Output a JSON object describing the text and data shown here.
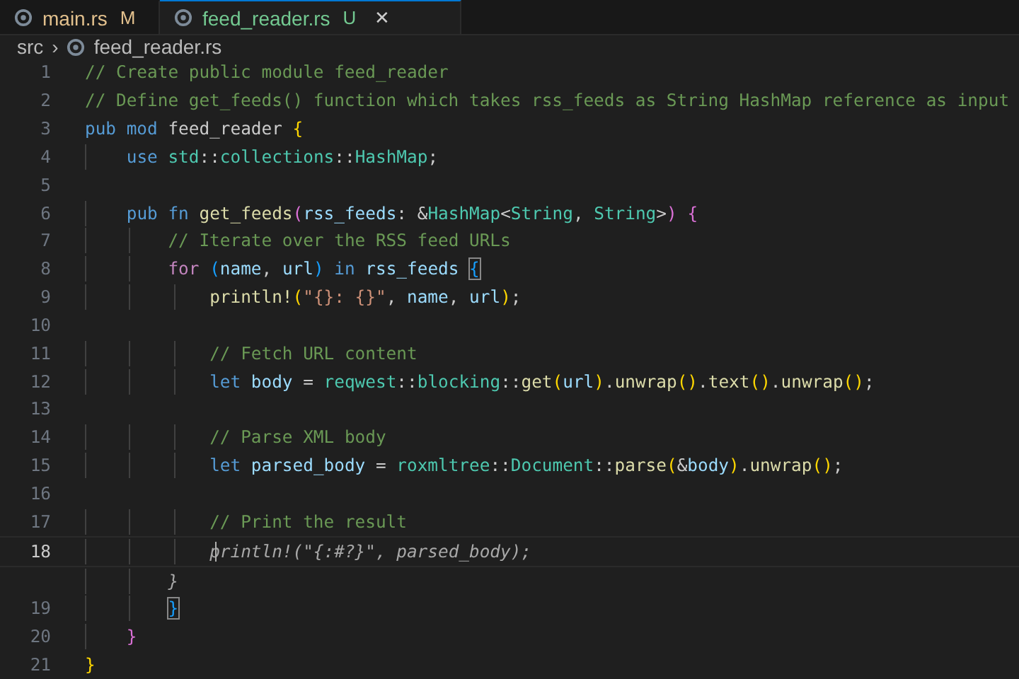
{
  "tabs": [
    {
      "label": "main.rs",
      "badge": "M",
      "selected": false,
      "closable": false
    },
    {
      "label": "feed_reader.rs",
      "badge": "U",
      "selected": true,
      "closable": true
    }
  ],
  "close_glyph": "✕",
  "breadcrumb": {
    "folder": "src",
    "separator": "›",
    "file": "feed_reader.rs"
  },
  "lines": [
    {
      "number": "1",
      "current": false,
      "tokens": [
        {
          "text": "// Create public module feed_reader",
          "kind": "comment"
        }
      ]
    },
    {
      "number": "2",
      "current": false,
      "tokens": [
        {
          "text": "// Define get_feeds() function which takes rss_feeds as String HashMap reference as input",
          "kind": "comment"
        }
      ]
    },
    {
      "number": "3",
      "current": false,
      "tokens": [
        {
          "text": "pub mod ",
          "kind": "keyword"
        },
        {
          "text": "feed_reader ",
          "kind": "plain"
        },
        {
          "text": "{",
          "kind": "bracket1"
        }
      ]
    },
    {
      "number": "4",
      "current": false,
      "tokens": [
        {
          "text": "    use ",
          "kind": "keyword"
        },
        {
          "text": "std",
          "kind": "type"
        },
        {
          "text": "::",
          "kind": "plain"
        },
        {
          "text": "collections",
          "kind": "type"
        },
        {
          "text": "::",
          "kind": "plain"
        },
        {
          "text": "HashMap",
          "kind": "type"
        },
        {
          "text": ";",
          "kind": "plain"
        }
      ]
    },
    {
      "number": "5",
      "current": false
    },
    {
      "number": "6",
      "current": false,
      "tokens": [
        {
          "text": "    pub fn ",
          "kind": "keyword"
        },
        {
          "text": "get_feeds",
          "kind": "func"
        },
        {
          "text": "(",
          "kind": "bracket2"
        },
        {
          "text": "rss_feeds",
          "kind": "var"
        },
        {
          "text": ": &",
          "kind": "plain"
        },
        {
          "text": "HashMap",
          "kind": "type"
        },
        {
          "text": "<",
          "kind": "plain"
        },
        {
          "text": "String",
          "kind": "type"
        },
        {
          "text": ", ",
          "kind": "plain"
        },
        {
          "text": "String",
          "kind": "type"
        },
        {
          "text": ">",
          "kind": "plain"
        },
        {
          "text": ") ",
          "kind": "bracket2"
        },
        {
          "text": "{",
          "kind": "bracket2"
        }
      ]
    },
    {
      "number": "7",
      "current": false,
      "tokens": [
        {
          "text": "        // Iterate over the RSS feed URLs",
          "kind": "comment"
        }
      ]
    },
    {
      "number": "8",
      "current": false,
      "tokens": [
        {
          "text": "        for ",
          "kind": "control"
        },
        {
          "text": "(",
          "kind": "bracket3"
        },
        {
          "text": "name",
          "kind": "var"
        },
        {
          "text": ", ",
          "kind": "plain"
        },
        {
          "text": "url",
          "kind": "var"
        },
        {
          "text": ") ",
          "kind": "bracket3"
        },
        {
          "text": "in ",
          "kind": "keyword"
        },
        {
          "text": "rss_feeds ",
          "kind": "var"
        },
        {
          "text": "{",
          "kind": "matched"
        }
      ]
    },
    {
      "number": "9",
      "current": false,
      "tokens": [
        {
          "text": "            println!",
          "kind": "func"
        },
        {
          "text": "(",
          "kind": "bracket1"
        },
        {
          "text": "\"{}: {}\"",
          "kind": "string"
        },
        {
          "text": ", ",
          "kind": "plain"
        },
        {
          "text": "name",
          "kind": "var"
        },
        {
          "text": ", ",
          "kind": "plain"
        },
        {
          "text": "url",
          "kind": "var"
        },
        {
          "text": ")",
          "kind": "bracket1"
        },
        {
          "text": ";",
          "kind": "plain"
        }
      ]
    },
    {
      "number": "10",
      "current": false
    },
    {
      "number": "11",
      "current": false,
      "tokens": [
        {
          "text": "            // Fetch URL content",
          "kind": "comment"
        }
      ]
    },
    {
      "number": "12",
      "current": false,
      "tokens": [
        {
          "text": "            let ",
          "kind": "keyword"
        },
        {
          "text": "body",
          "kind": "var"
        },
        {
          "text": " = ",
          "kind": "plain"
        },
        {
          "text": "reqwest",
          "kind": "type"
        },
        {
          "text": "::",
          "kind": "plain"
        },
        {
          "text": "blocking",
          "kind": "type"
        },
        {
          "text": "::",
          "kind": "plain"
        },
        {
          "text": "get",
          "kind": "func"
        },
        {
          "text": "(",
          "kind": "bracket1"
        },
        {
          "text": "url",
          "kind": "var"
        },
        {
          "text": ")",
          "kind": "bracket1"
        },
        {
          "text": ".",
          "kind": "plain"
        },
        {
          "text": "unwrap",
          "kind": "func"
        },
        {
          "text": "()",
          "kind": "bracket1"
        },
        {
          "text": ".",
          "kind": "plain"
        },
        {
          "text": "text",
          "kind": "func"
        },
        {
          "text": "()",
          "kind": "bracket1"
        },
        {
          "text": ".",
          "kind": "plain"
        },
        {
          "text": "unwrap",
          "kind": "func"
        },
        {
          "text": "()",
          "kind": "bracket1"
        },
        {
          "text": ";",
          "kind": "plain"
        }
      ]
    },
    {
      "number": "13",
      "current": false
    },
    {
      "number": "14",
      "current": false,
      "tokens": [
        {
          "text": "            // Parse XML body",
          "kind": "comment"
        }
      ]
    },
    {
      "number": "15",
      "current": false,
      "tokens": [
        {
          "text": "            let ",
          "kind": "keyword"
        },
        {
          "text": "parsed_body",
          "kind": "var"
        },
        {
          "text": " = ",
          "kind": "plain"
        },
        {
          "text": "roxmltree",
          "kind": "type"
        },
        {
          "text": "::",
          "kind": "plain"
        },
        {
          "text": "Document",
          "kind": "type"
        },
        {
          "text": "::",
          "kind": "plain"
        },
        {
          "text": "parse",
          "kind": "func"
        },
        {
          "text": "(",
          "kind": "bracket1"
        },
        {
          "text": "&",
          "kind": "plain"
        },
        {
          "text": "body",
          "kind": "var"
        },
        {
          "text": ")",
          "kind": "bracket1"
        },
        {
          "text": ".",
          "kind": "plain"
        },
        {
          "text": "unwrap",
          "kind": "func"
        },
        {
          "text": "()",
          "kind": "bracket1"
        },
        {
          "text": ";",
          "kind": "plain"
        }
      ]
    },
    {
      "number": "16",
      "current": false
    },
    {
      "number": "17",
      "current": false,
      "tokens": [
        {
          "text": "            // Print the result",
          "kind": "comment"
        }
      ]
    },
    {
      "number": "18",
      "current": true,
      "tokens": [
        {
          "text": "            println!(\"{:#?}\", parsed_body);",
          "kind": "ghost"
        }
      ]
    },
    {
      "current": false,
      "tokens": [
        {
          "text": "        }",
          "kind": "ghost"
        }
      ]
    },
    {
      "number": "19",
      "current": false,
      "tokens": [
        {
          "text": "        }",
          "kind": "matched"
        }
      ]
    },
    {
      "number": "20",
      "current": false,
      "tokens": [
        {
          "text": "    }",
          "kind": "bracket2"
        }
      ]
    },
    {
      "number": "21",
      "current": false,
      "tokens": [
        {
          "text": "}",
          "kind": "bracket1"
        }
      ]
    }
  ]
}
